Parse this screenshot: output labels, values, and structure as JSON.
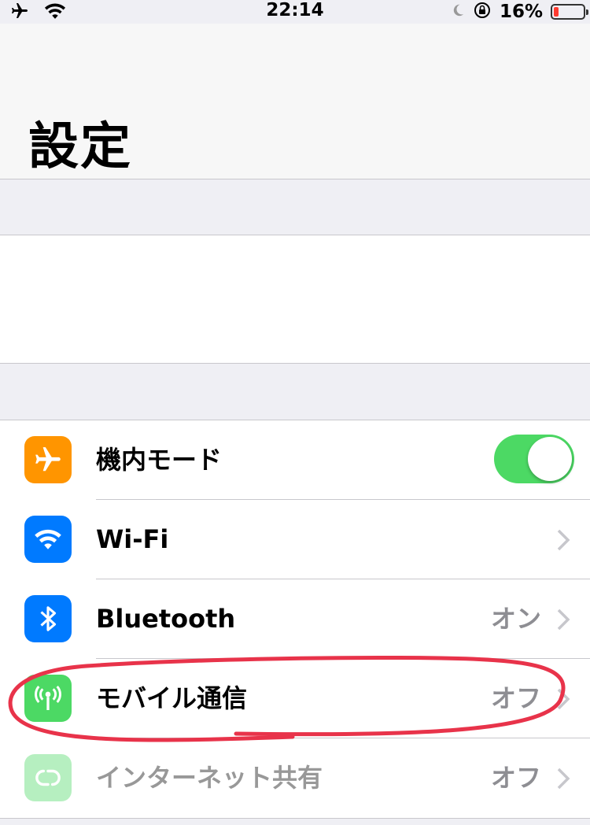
{
  "status_bar": {
    "time": "22:14",
    "battery_percent": "16%",
    "battery_level": 0.16,
    "icons": [
      "airplane-icon",
      "wifi-icon",
      "moon-icon",
      "rotation-lock-icon",
      "battery-icon"
    ]
  },
  "header": {
    "title": "設定"
  },
  "colors": {
    "airplane": "#ff9500",
    "wifi": "#007aff",
    "bluetooth": "#007aff",
    "cellular": "#4cd964",
    "hotspot": "#4cd964",
    "toggle_on": "#4cd964",
    "annotation": "#e8334a"
  },
  "settings": {
    "airplane": {
      "label": "機内モード",
      "toggle_on": true,
      "icon": "airplane-icon"
    },
    "wifi": {
      "label": "Wi-Fi",
      "icon": "wifi-icon"
    },
    "bluetooth": {
      "label": "Bluetooth",
      "value": "オン",
      "icon": "bluetooth-icon"
    },
    "cellular": {
      "label": "モバイル通信",
      "value": "オフ",
      "icon": "antenna-icon"
    },
    "hotspot": {
      "label": "インターネット共有",
      "value": "オフ",
      "icon": "hotspot-icon"
    }
  }
}
